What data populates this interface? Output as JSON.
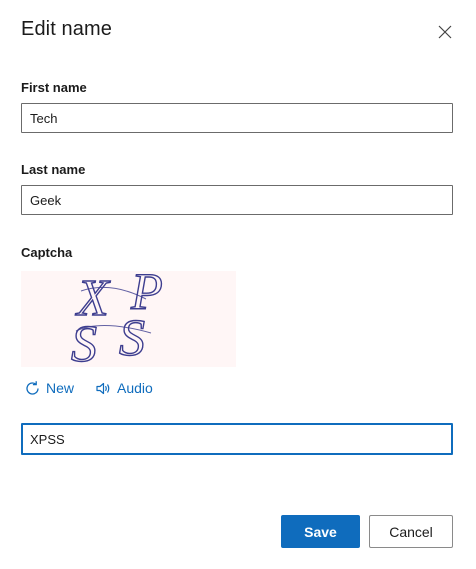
{
  "dialog": {
    "title": "Edit name",
    "close_icon": "close-icon"
  },
  "fields": {
    "first_name": {
      "label": "First name",
      "value": "Tech"
    },
    "last_name": {
      "label": "Last name",
      "value": "Geek"
    },
    "captcha": {
      "label": "Captcha",
      "image_text": "XPSS",
      "new_label": "New",
      "new_icon": "refresh-icon",
      "audio_label": "Audio",
      "audio_icon": "speaker-icon",
      "value": "XPSS"
    }
  },
  "buttons": {
    "save_label": "Save",
    "cancel_label": "Cancel"
  },
  "colors": {
    "accent": "#0f6cbd",
    "captcha_bg": "#fff6f6",
    "captcha_ink": "#3d3d8f"
  }
}
